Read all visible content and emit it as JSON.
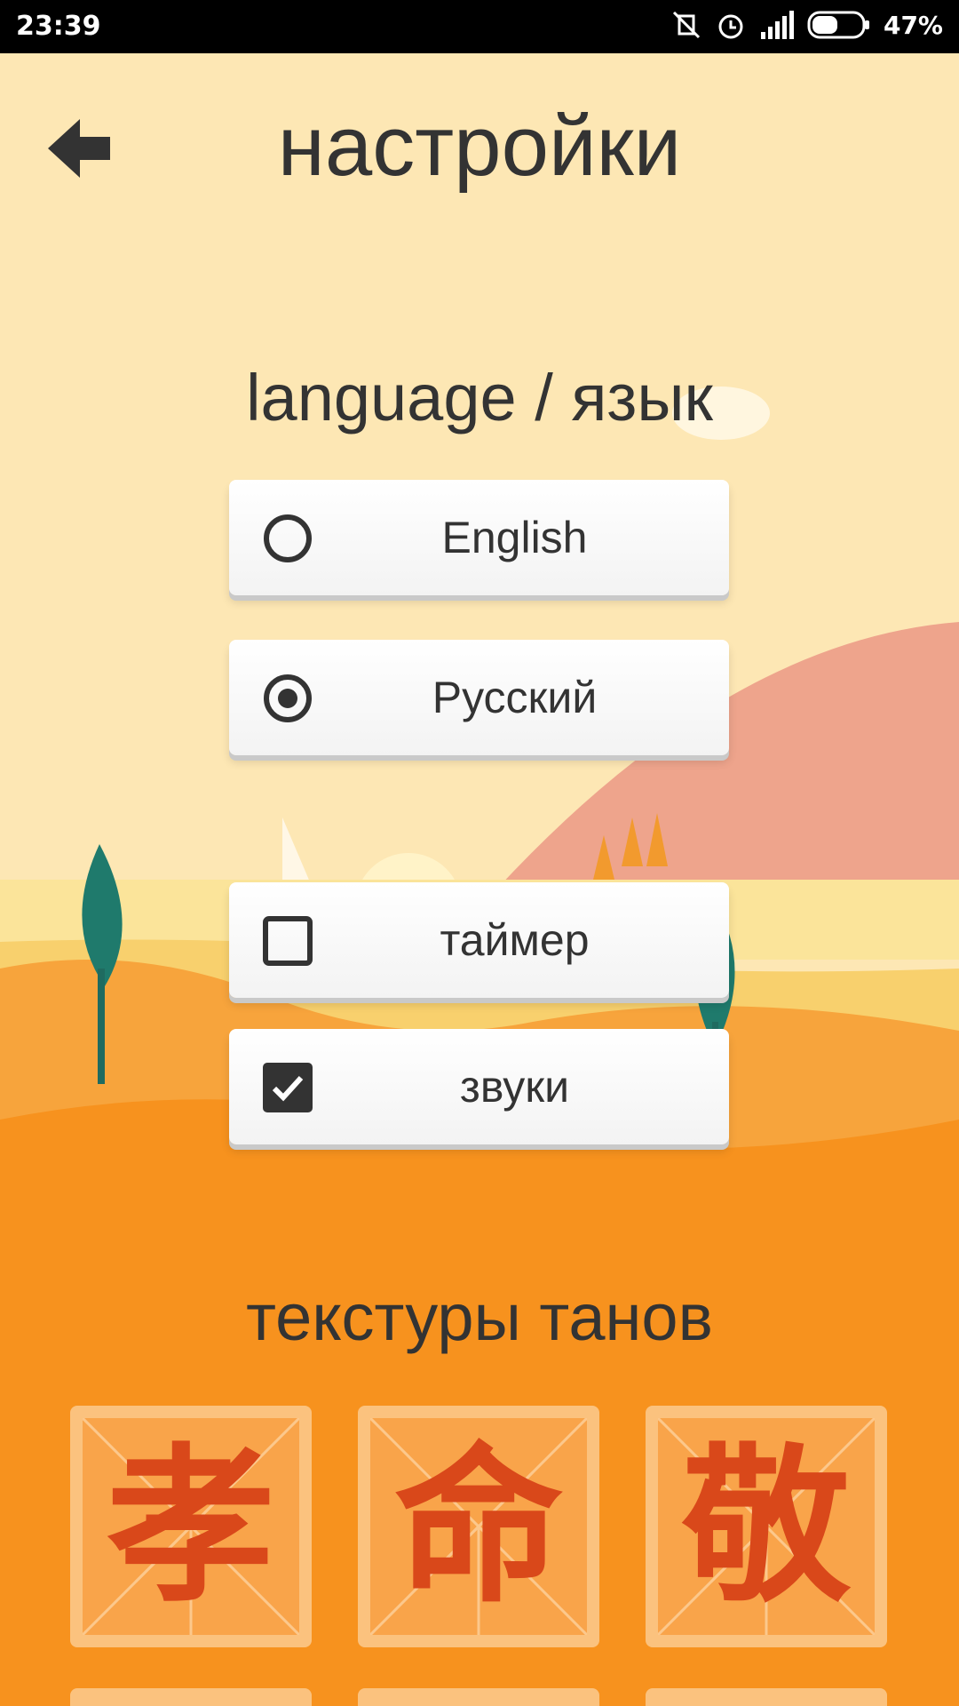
{
  "status_bar": {
    "time": "23:39",
    "battery_percent": "47%",
    "icons": [
      "vibrate-off-icon",
      "alarm-icon",
      "signal-icon",
      "battery-icon"
    ]
  },
  "header": {
    "title": "настройки",
    "back_icon": "arrow-left-icon"
  },
  "language": {
    "title": "language / язык",
    "options": [
      {
        "label": "English",
        "selected": false
      },
      {
        "label": "Русский",
        "selected": true
      }
    ]
  },
  "toggles": [
    {
      "label": "таймер",
      "checked": false
    },
    {
      "label": "звуки",
      "checked": true
    }
  ],
  "textures": {
    "title": "текстуры танов",
    "tiles": [
      {
        "glyph": "孝"
      },
      {
        "glyph": "命"
      },
      {
        "glyph": "敬"
      }
    ]
  },
  "colors": {
    "sky": "#fde7b4",
    "orange": "#f7921e",
    "hill_pink": "#eea48c",
    "text": "#333333"
  }
}
